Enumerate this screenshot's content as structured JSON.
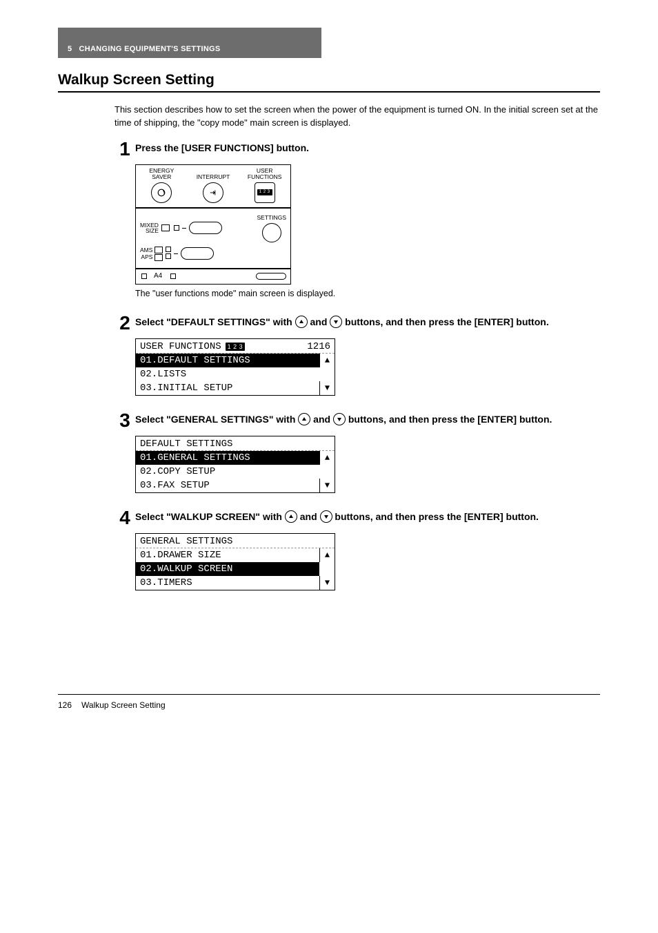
{
  "chapter": {
    "number": "5",
    "title": "CHANGING EQUIPMENT'S SETTINGS"
  },
  "section_title": "Walkup Screen Setting",
  "intro": "This section describes how to set the screen when the power of the equipment is turned ON. In the initial screen set at the time of shipping, the \"copy mode\" main screen is displayed.",
  "steps": {
    "s1": {
      "num": "1",
      "title": "Press the [USER FUNCTIONS] button.",
      "caption": "The \"user functions mode\" main screen is displayed.",
      "panel": {
        "top": {
          "col1a": "ENERGY",
          "col1b": "SAVER",
          "col2": "INTERRUPT",
          "col3a": "USER",
          "col3b": "FUNCTIONS",
          "badge": "1 2 3"
        },
        "mid": {
          "mixed1": "MIXED",
          "mixed2": "SIZE",
          "ams": "AMS",
          "aps": "APS",
          "settings": "SETTINGS"
        },
        "bot": {
          "a4": "A4"
        }
      }
    },
    "s2": {
      "num": "2",
      "title_pre": "Select \"DEFAULT SETTINGS\" with ",
      "title_mid": " and ",
      "title_post": " buttons, and then press the [ENTER] button.",
      "lcd": {
        "title": "USER FUNCTIONS",
        "badge": "1 2 3",
        "num": "1216",
        "r1": "01.DEFAULT SETTINGS",
        "r2": "02.LISTS",
        "r3": "03.INITIAL SETUP"
      }
    },
    "s3": {
      "num": "3",
      "title_pre": "Select \"GENERAL SETTINGS\" with ",
      "title_mid": " and ",
      "title_post": " buttons, and then press the [ENTER] button.",
      "lcd": {
        "title": "DEFAULT SETTINGS",
        "r1": "01.GENERAL SETTINGS",
        "r2": "02.COPY SETUP",
        "r3": "03.FAX SETUP"
      }
    },
    "s4": {
      "num": "4",
      "title_pre": "Select \"WALKUP SCREEN\" with ",
      "title_mid": " and ",
      "title_post": " buttons, and then press the [ENTER] button.",
      "lcd": {
        "title": "GENERAL SETTINGS",
        "r1": "01.DRAWER SIZE",
        "r2": "02.WALKUP SCREEN",
        "r3": "03.TIMERS"
      }
    }
  },
  "footer": {
    "page": "126",
    "label": "Walkup Screen Setting"
  }
}
